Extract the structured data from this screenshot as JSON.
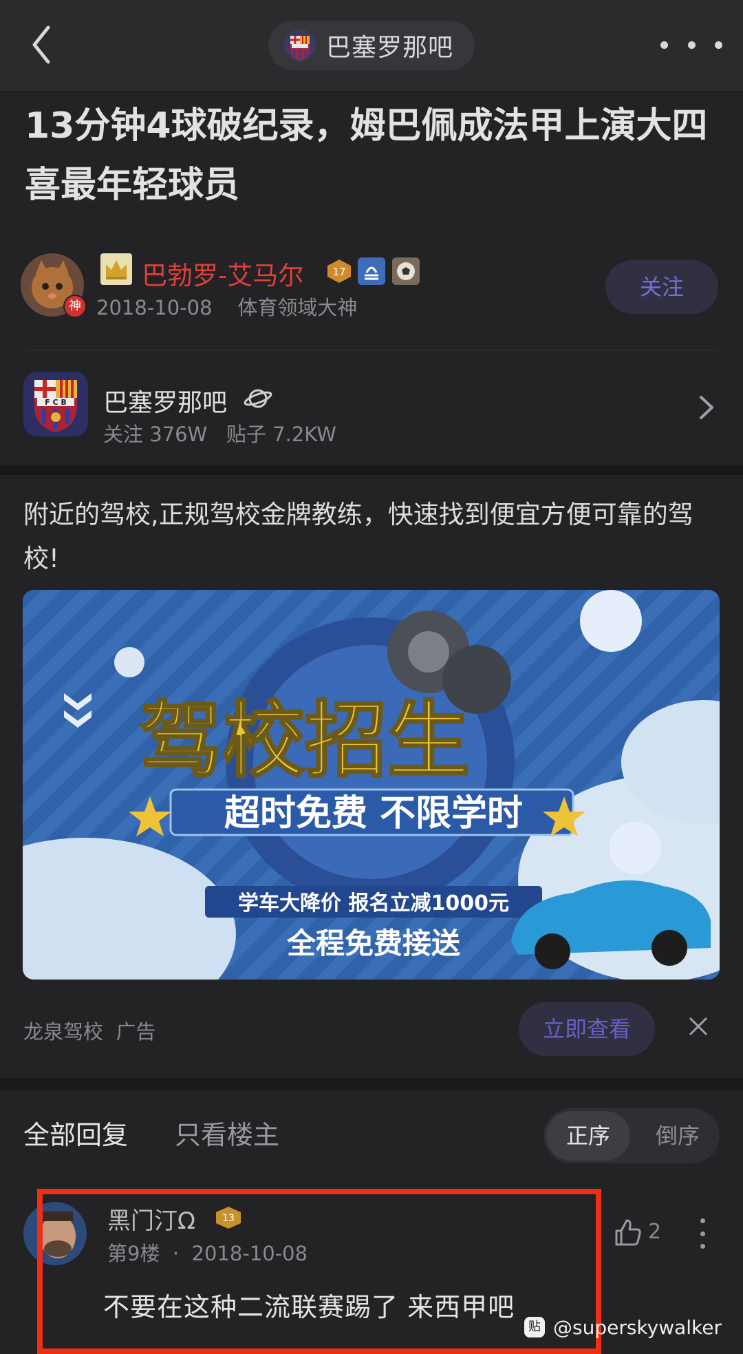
{
  "header": {
    "forum_name": "巴塞罗那吧",
    "back_icon": "chevron-left-icon",
    "more_icon": "more-horizontal-icon"
  },
  "post": {
    "title": "13分钟4球破纪录，姆巴佩成法甲上演大四喜最年轻球员",
    "author": {
      "badge_text": "神",
      "name": "巴勃罗-艾马尔",
      "level": "17",
      "date": "2018-10-08",
      "honor": "体育领域大神",
      "name_color": "#e0403c"
    },
    "follow_label": "关注"
  },
  "forum_card": {
    "name": "巴塞罗那吧",
    "followers_label": "关注",
    "followers": "376W",
    "posts_label": "贴子",
    "posts": "7.2KW"
  },
  "ad": {
    "text": "附近的驾校,正规驾校金牌教练，快速找到便宜方便可靠的驾校!",
    "banner": {
      "headline": "驾校招生",
      "slogan": "超时免费 不限学时",
      "promo": "学车大降价 报名立减1000元",
      "footer": "全程免费接送"
    },
    "advertiser": "龙泉驾校",
    "ad_label": "广告",
    "cta_label": "立即查看"
  },
  "replies": {
    "tab_all": "全部回复",
    "tab_owner": "只看楼主",
    "sort_asc": "正序",
    "sort_desc": "倒序",
    "items": [
      {
        "user": "黑门汀Ω",
        "level": "13",
        "floor": "第9楼",
        "date": "2018-10-08",
        "likes": "2",
        "body": "不要在这种二流联赛踢了 来西甲吧"
      }
    ]
  },
  "watermark": {
    "logo": "贴",
    "handle": "@superskywalker"
  },
  "colors": {
    "accent_purple": "#7a6cd8",
    "highlight_red": "#ee2f16",
    "background": "#232325"
  }
}
